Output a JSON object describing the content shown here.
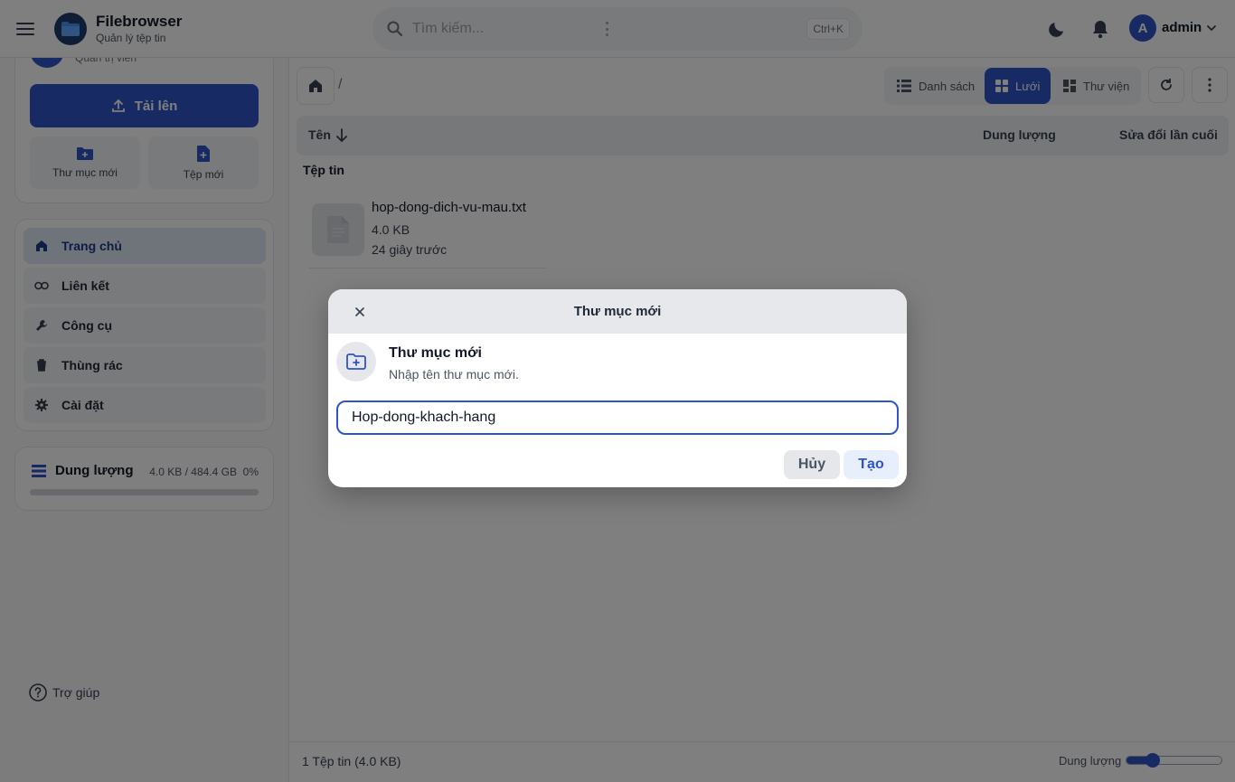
{
  "header": {
    "app_title": "Filebrowser",
    "app_subtitle": "Quản lý tệp tin",
    "search_placeholder": "Tìm kiếm...",
    "search_shortcut": "Ctrl+K",
    "user_initial": "A",
    "user_name": "admin",
    "icons": [
      "menu-icon",
      "folder-logo-icon",
      "search-icon",
      "moon-icon",
      "bell-icon",
      "chevron-down-icon"
    ]
  },
  "sidebar": {
    "profile_role": "Quản trị viên",
    "upload_label": "Tải lên",
    "new_folder_label": "Thư mục mới",
    "new_file_label": "Tệp mới",
    "nav": [
      {
        "label": "Trang chủ",
        "icon": "home-icon",
        "active": true
      },
      {
        "label": "Liên kết",
        "icon": "link-icon",
        "active": false
      },
      {
        "label": "Công cụ",
        "icon": "wrench-icon",
        "active": false
      },
      {
        "label": "Thùng rác",
        "icon": "trash-icon",
        "active": false
      },
      {
        "label": "Cài đặt",
        "icon": "gear-icon",
        "active": false
      }
    ],
    "storage": {
      "title": "Dung lượng",
      "value": "4.0 KB / 484.4 GB",
      "percent_text": "0%",
      "fraction": 0.0
    },
    "help_label": "Trợ giúp"
  },
  "main": {
    "breadcrumb_sep": "/",
    "views": [
      "Danh sách",
      "Lưới",
      "Thư viện"
    ],
    "active_view": "Lưới",
    "columns": {
      "name": "Tên",
      "size": "Dung lượng",
      "modified": "Sửa đổi lần cuối"
    },
    "section_label": "Tệp tin",
    "files": [
      {
        "name": "hop-dong-dich-vu-mau.txt",
        "size": "4.0 KB",
        "modified": "24 giây trước"
      }
    ],
    "footer_summary": "1 Tệp tin (4.0 KB)",
    "footer_zoom_label": "Dung lượng",
    "zoom_fraction": 0.28
  },
  "dialog": {
    "title": "Thư mục mới",
    "heading": "Thư mục mới",
    "description": "Nhập tên thư mục mới.",
    "input_value": "Hop-dong-khach-hang",
    "cancel_label": "Hủy",
    "create_label": "Tạo"
  },
  "colors": {
    "accent": "#2f54c9",
    "overlay": "rgba(0,0,0,0.5)",
    "active_nav_bg": "#dfe6f5"
  }
}
